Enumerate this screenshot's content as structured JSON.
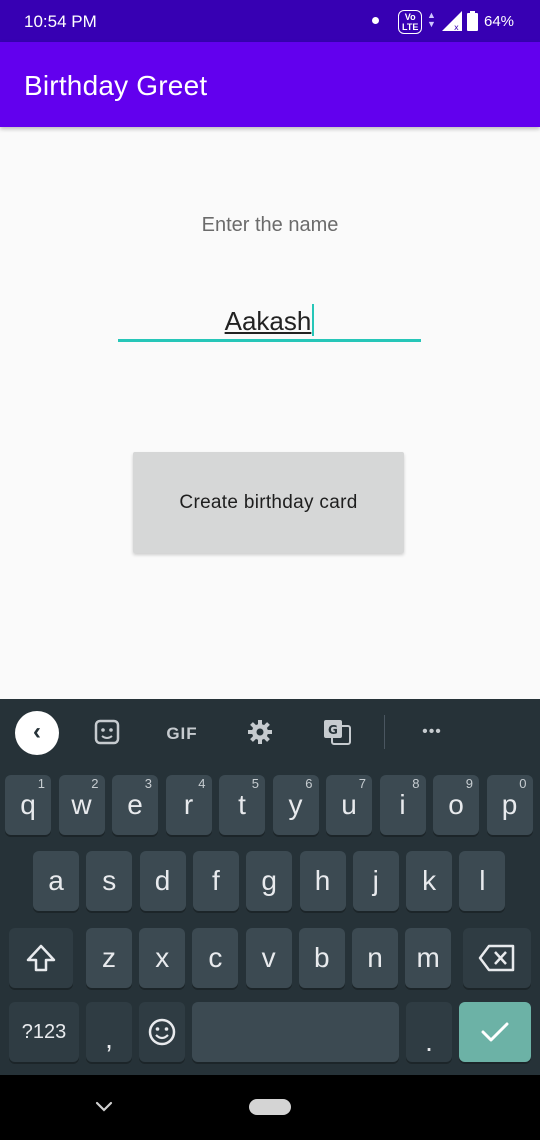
{
  "status_bar": {
    "time": "10:54 PM",
    "volte": "VoLTE",
    "battery": "64%"
  },
  "app_bar": {
    "title": "Birthday Greet"
  },
  "form": {
    "label": "Enter the name",
    "name_value": "Aakash",
    "button_label": "Create birthday card"
  },
  "keyboard": {
    "toolbar": {
      "back": "‹",
      "gif": "GIF",
      "more": "•••"
    },
    "row1": [
      {
        "label": "q",
        "hint": "1"
      },
      {
        "label": "w",
        "hint": "2"
      },
      {
        "label": "e",
        "hint": "3"
      },
      {
        "label": "r",
        "hint": "4"
      },
      {
        "label": "t",
        "hint": "5"
      },
      {
        "label": "y",
        "hint": "6"
      },
      {
        "label": "u",
        "hint": "7"
      },
      {
        "label": "i",
        "hint": "8"
      },
      {
        "label": "o",
        "hint": "9"
      },
      {
        "label": "p",
        "hint": "0"
      }
    ],
    "row2": [
      "a",
      "s",
      "d",
      "f",
      "g",
      "h",
      "j",
      "k",
      "l"
    ],
    "row3": [
      "z",
      "x",
      "c",
      "v",
      "b",
      "n",
      "m"
    ],
    "row4": {
      "symbols": "?123",
      "comma": ",",
      "period": "."
    }
  },
  "colors": {
    "status_bar": "#3700b3",
    "app_bar": "#6200ee",
    "accent": "#26c6b8",
    "keyboard_bg": "#263238",
    "key_bg": "#3c4a52",
    "enter_key": "#6cb2a6"
  }
}
